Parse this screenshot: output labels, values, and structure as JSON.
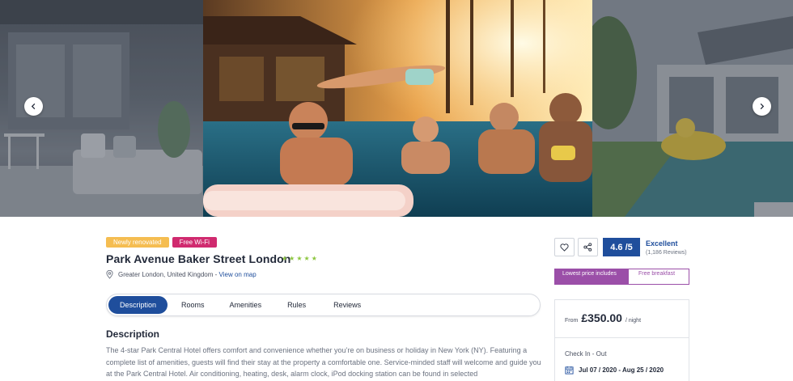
{
  "tags": {
    "renovated": "Newly renovated",
    "wifi": "Free Wi-Fi"
  },
  "hotel": {
    "name": "Park Avenue Baker Street London",
    "stars": 5,
    "location": "Greater London, United Kingdom",
    "separator": "-",
    "map_link": "View on map"
  },
  "tabs": [
    {
      "label": "Description",
      "active": true
    },
    {
      "label": "Rooms",
      "active": false
    },
    {
      "label": "Amenities",
      "active": false
    },
    {
      "label": "Rules",
      "active": false
    },
    {
      "label": "Reviews",
      "active": false
    }
  ],
  "description": {
    "heading": "Description",
    "text": "The 4-star Park Central Hotel offers comfort and convenience whether you’re on business or holiday in New York (NY). Featuring a complete list of amenities, guests will find their stay at the property a comfortable one. Service-minded staff will welcome and guide you at the Park Central Hotel. Air conditioning, heating, desk, alarm clock, iPod docking station can be found in selected"
  },
  "rating": {
    "score": "4.6 /5",
    "label": "Excellent",
    "count": "(1,186 Reviews)"
  },
  "promo": {
    "left": "Lowest price includes",
    "right": "Free breakfast"
  },
  "booking": {
    "from": "From",
    "price": "£350.00",
    "per": "/ night",
    "checkin_label": "Check In - Out",
    "dates": "Jul 07 / 2020 - Aug 25 / 2020"
  },
  "icons": {
    "prev": "chevron-left-icon",
    "next": "chevron-right-icon",
    "wishlist": "heart-icon",
    "share": "share-icon",
    "location": "map-pin-icon",
    "calendar": "calendar-icon",
    "star": "star-icon"
  },
  "colors": {
    "primary": "#1f4e9c",
    "renovated": "#f5bd51",
    "wifi": "#d02a6f",
    "promo": "#9b4fa8",
    "stars": "#8cc63f"
  }
}
